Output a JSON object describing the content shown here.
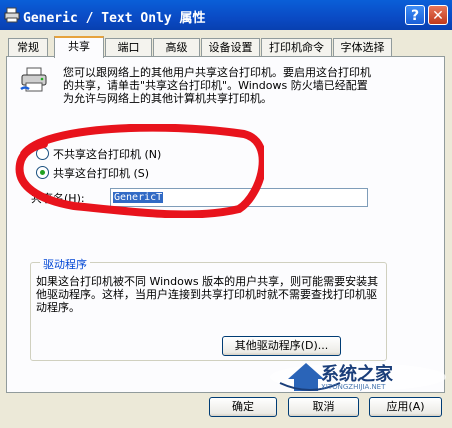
{
  "window": {
    "title": "Generic / Text Only 属性",
    "help_label": "?",
    "close_label": "✕"
  },
  "tabs": [
    {
      "label": "常规"
    },
    {
      "label": "共享",
      "active": true
    },
    {
      "label": "端口"
    },
    {
      "label": "高级"
    },
    {
      "label": "设备设置"
    },
    {
      "label": "打印机命令"
    },
    {
      "label": "字体选择"
    }
  ],
  "share": {
    "info_text": "您可以跟网络上的其他用户共享这台打印机。要启用这台打印机的共享，请单击\"共享这台打印机\"。Windows 防火墙已经配置为允许与网络上的其他计算机共享打印机。",
    "no_share_label": "不共享这台打印机 (N)",
    "share_label": "共享这台打印机 (S)",
    "share_checked": true,
    "share_name_label": "共享名(H):",
    "share_name_value": "GenericT"
  },
  "drivers": {
    "title": "驱动程序",
    "description": "如果这台打印机被不同 Windows 版本的用户共享，则可能需要安装其他驱动程序。这样，当用户连接到共享打印机时就不需要查找打印机驱动程序。",
    "other_drivers_button": "其他驱动程序(D)..."
  },
  "buttons": {
    "ok": "确定",
    "cancel": "取消",
    "apply": "应用(A)"
  },
  "watermark": {
    "text": "系统之家",
    "subtext": "XITONGZHIJIA.NET"
  },
  "colors": {
    "titlebar": "#0a4ac4",
    "annotation": "#e8131c",
    "link_blue": "#0046d5"
  }
}
